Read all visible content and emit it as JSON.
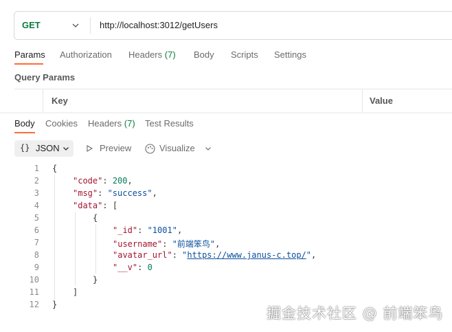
{
  "request": {
    "method": "GET",
    "url": "http://localhost:3012/getUsers"
  },
  "request_tabs": [
    {
      "label": "Params",
      "active": true
    },
    {
      "label": "Authorization"
    },
    {
      "label": "Headers",
      "count": "(7)"
    },
    {
      "label": "Body"
    },
    {
      "label": "Scripts"
    },
    {
      "label": "Settings"
    }
  ],
  "query_params": {
    "title": "Query Params",
    "columns": [
      "Key",
      "Value"
    ]
  },
  "response_tabs": [
    {
      "label": "Body",
      "active": true
    },
    {
      "label": "Cookies"
    },
    {
      "label": "Headers",
      "count": "(7)"
    },
    {
      "label": "Test Results"
    }
  ],
  "response_toolbar": {
    "format_icon": "{}",
    "format": "JSON",
    "preview": "Preview",
    "visualize": "Visualize"
  },
  "response_body": {
    "line_numbers": [
      "1",
      "2",
      "3",
      "4",
      "5",
      "6",
      "7",
      "8",
      "9",
      "10",
      "11",
      "12"
    ],
    "open_brace": "{",
    "code_key": "\"code\"",
    "code_val": "200",
    "msg_key": "\"msg\"",
    "msg_val": "\"success\"",
    "data_key": "\"data\"",
    "array_open": "[",
    "obj_open": "{",
    "id_key": "\"_id\"",
    "id_val": "\"1001\"",
    "username_key": "\"username\"",
    "username_val": "\"前端笨鸟\"",
    "avatar_key": "\"avatar_url\"",
    "avatar_val_q": "\"",
    "avatar_link": "https://www.janus-c.top/",
    "v_key": "\"__v\"",
    "v_val": "0",
    "obj_close": "}",
    "array_close": "]",
    "close_brace": "}"
  },
  "watermark": "掘金技术社区 @ 前端笨鸟"
}
